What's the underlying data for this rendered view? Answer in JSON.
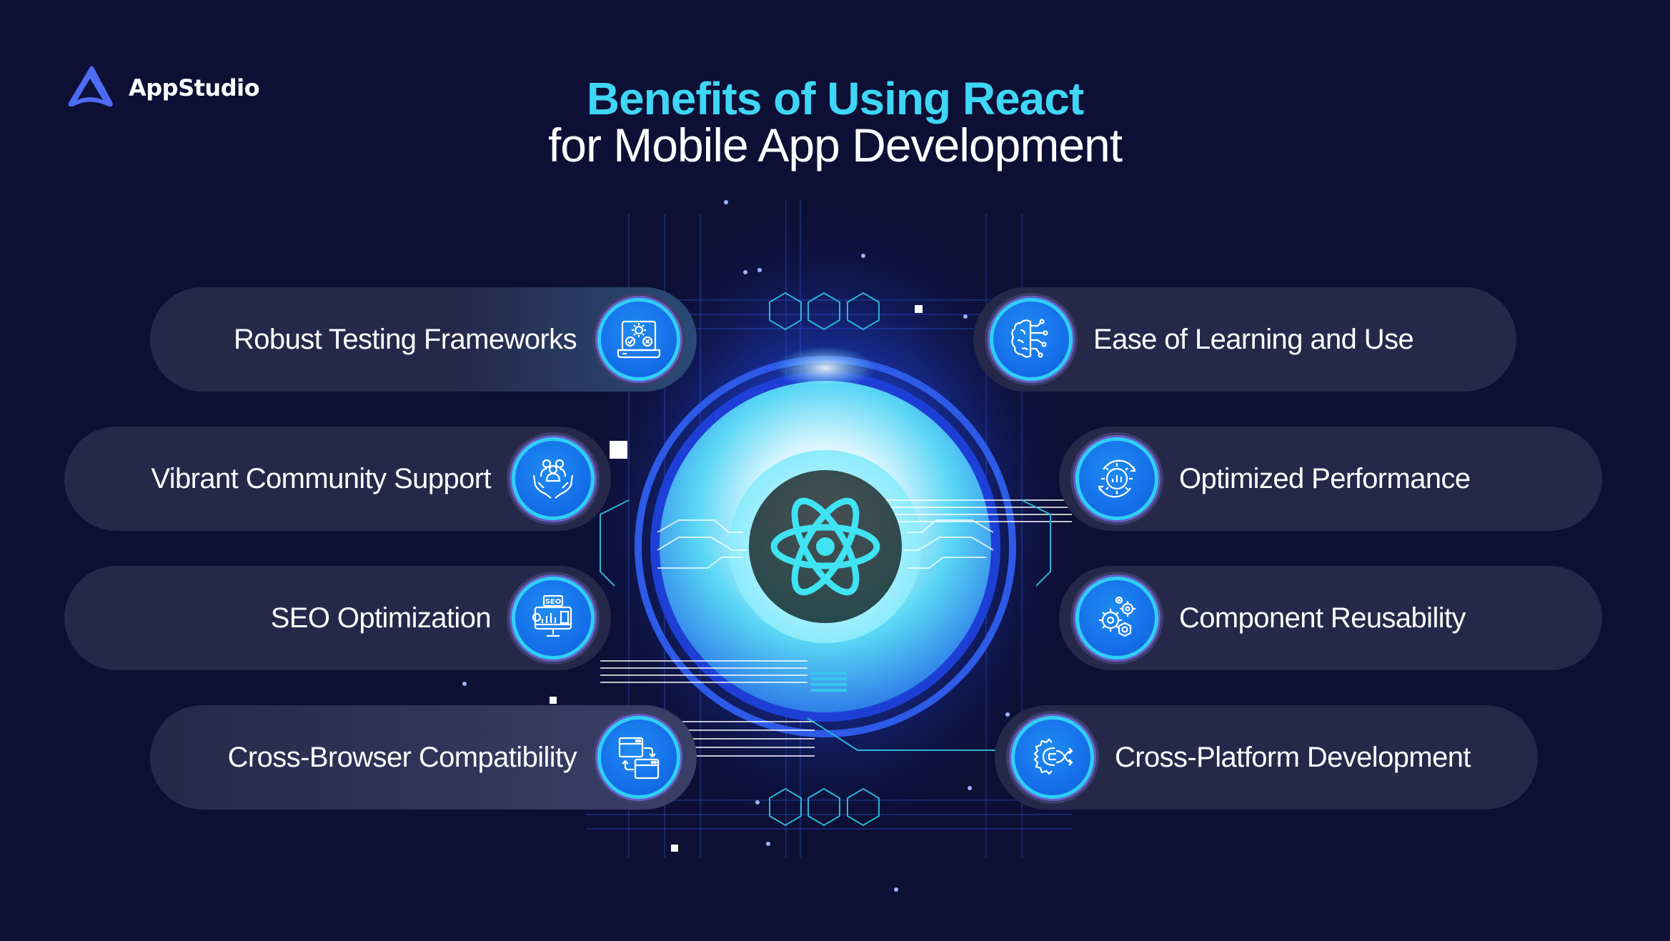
{
  "brand": {
    "name": "AppStudio",
    "logo_icon": "appstudio-triangle-logo",
    "logo_color": "#4d6bf2"
  },
  "title": {
    "line1": "Benefits of Using React",
    "line2": "for Mobile App Development",
    "line1_color": "#3fd6f5",
    "line2_color": "#ffffff"
  },
  "center": {
    "icon": "react-atom-icon",
    "icon_color": "#3fe3f2"
  },
  "benefits_left": [
    {
      "label": "Robust Testing Frameworks",
      "icon": "laptop-gear-check-icon"
    },
    {
      "label": "Vibrant Community Support",
      "icon": "hands-community-icon"
    },
    {
      "label": "SEO Optimization",
      "icon": "seo-monitor-icon"
    },
    {
      "label": "Cross-Browser Compatibility",
      "icon": "browser-sync-icon"
    }
  ],
  "benefits_right": [
    {
      "label": "Ease of Learning and Use",
      "icon": "brain-circuit-icon"
    },
    {
      "label": "Optimized Performance",
      "icon": "gear-chart-cycle-icon"
    },
    {
      "label": "Component Reusability",
      "icon": "gears-reuse-icon"
    },
    {
      "label": "Cross-Platform Development",
      "icon": "gear-arrows-platform-icon"
    }
  ],
  "colors": {
    "background": "#0d0f35",
    "pill": "#252849",
    "icon_disc": "#1570ea",
    "icon_ring": "#2fd0f6"
  }
}
